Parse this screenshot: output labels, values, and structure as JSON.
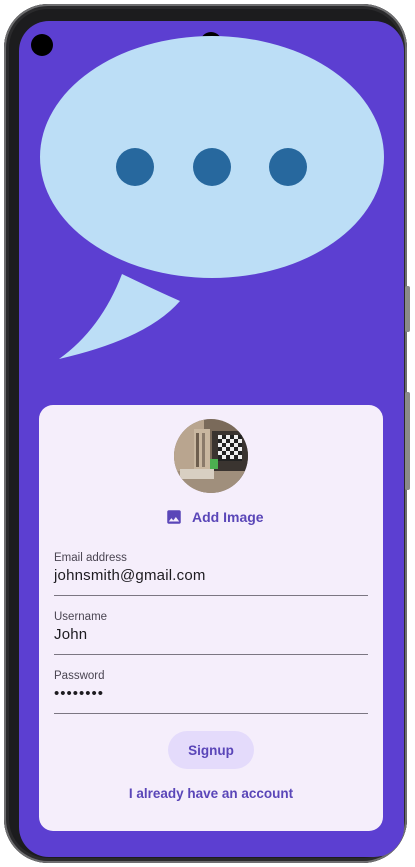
{
  "colors": {
    "background": "#5c3fd1",
    "card": "#f5eefb",
    "accent": "#5a46b8",
    "bubble": "#bcdef6",
    "bubble_dots": "#27689e",
    "button_fill": "#e4dbfb"
  },
  "header": {
    "illustration_icon": "chat-bubble-icon"
  },
  "avatar": {
    "icon": "profile-photo"
  },
  "add_image": {
    "icon": "image-icon",
    "label": "Add Image"
  },
  "form": {
    "email": {
      "label": "Email address",
      "value": "johnsmith@gmail.com"
    },
    "username": {
      "label": "Username",
      "value": "John"
    },
    "password": {
      "label": "Password",
      "value": "••••••••"
    }
  },
  "actions": {
    "signup_label": "Signup",
    "login_link": "I already have an account"
  }
}
